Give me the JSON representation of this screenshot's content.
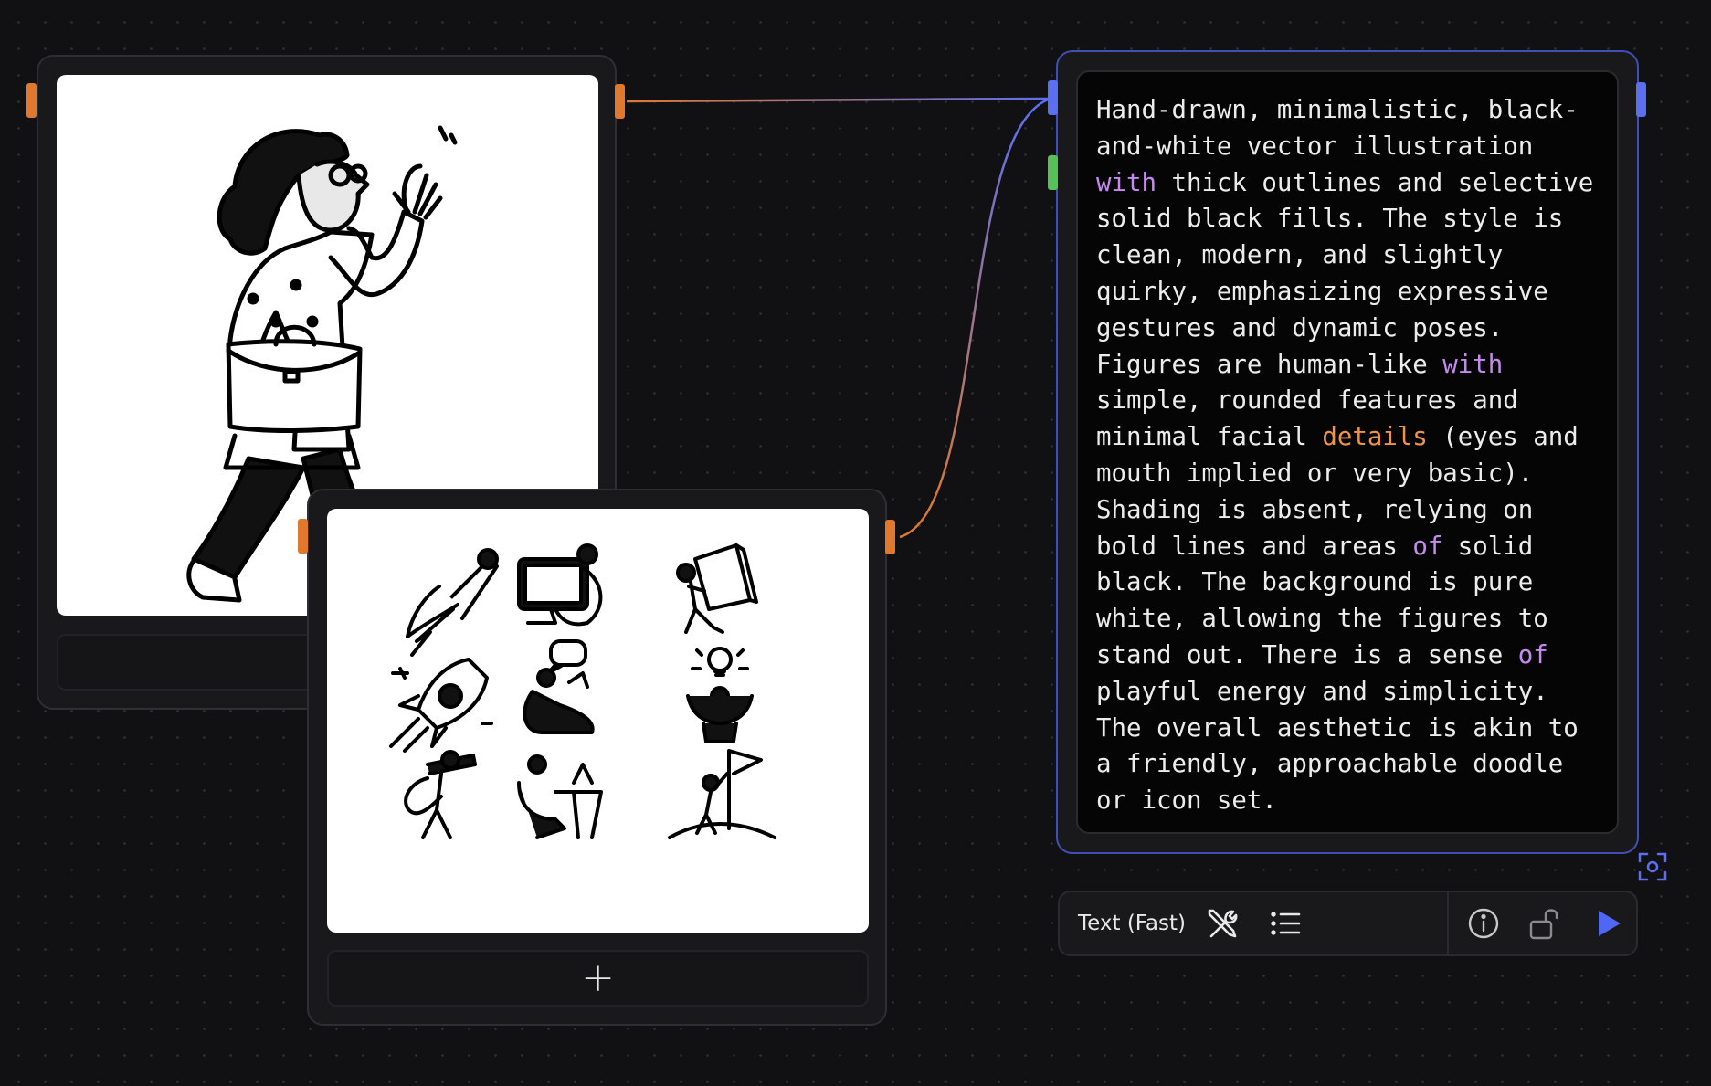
{
  "canvas": {
    "background": "#111113",
    "wire_orange": "#e0782e",
    "wire_blue": "#5b6ff0",
    "port_green": "#57c157"
  },
  "image_node_1": {
    "subject": "woman-walking-waving-illustration"
  },
  "image_node_2": {
    "subject": "doodle-icon-grid-illustrations",
    "add_label": "+"
  },
  "text_node": {
    "segments": [
      {
        "text": "Hand-drawn, minimalistic, black-and-white vector illustration ",
        "style": "plain"
      },
      {
        "text": "with",
        "style": "purple"
      },
      {
        "text": " thick outlines and selective solid black fills. The style is clean, modern, and slightly quirky, emphasizing expressive gestures and dynamic poses. Figures are human-like ",
        "style": "plain"
      },
      {
        "text": "with",
        "style": "purple"
      },
      {
        "text": " simple, rounded features and minimal facial ",
        "style": "plain"
      },
      {
        "text": "details",
        "style": "orange"
      },
      {
        "text": " (eyes and mouth implied or very basic). Shading is absent, relying on bold lines and areas ",
        "style": "plain"
      },
      {
        "text": "of",
        "style": "purple"
      },
      {
        "text": " solid black. The background is pure white, allowing the figures to stand out. There is a sense ",
        "style": "plain"
      },
      {
        "text": "of",
        "style": "purple"
      },
      {
        "text": " playful energy and simplicity. The overall aesthetic is akin to a friendly, approachable doodle or icon set.",
        "style": "plain"
      }
    ],
    "colors": {
      "plain": "#ececec",
      "purple": "#c58af0",
      "orange": "#ee9448",
      "border": "#3f4fb6"
    }
  },
  "toolbar": {
    "model_label": "Text (Fast)",
    "icons": [
      "tools-icon",
      "list-icon",
      "info-icon",
      "unlock-icon",
      "play-icon"
    ],
    "play_color": "#4f67f2"
  }
}
